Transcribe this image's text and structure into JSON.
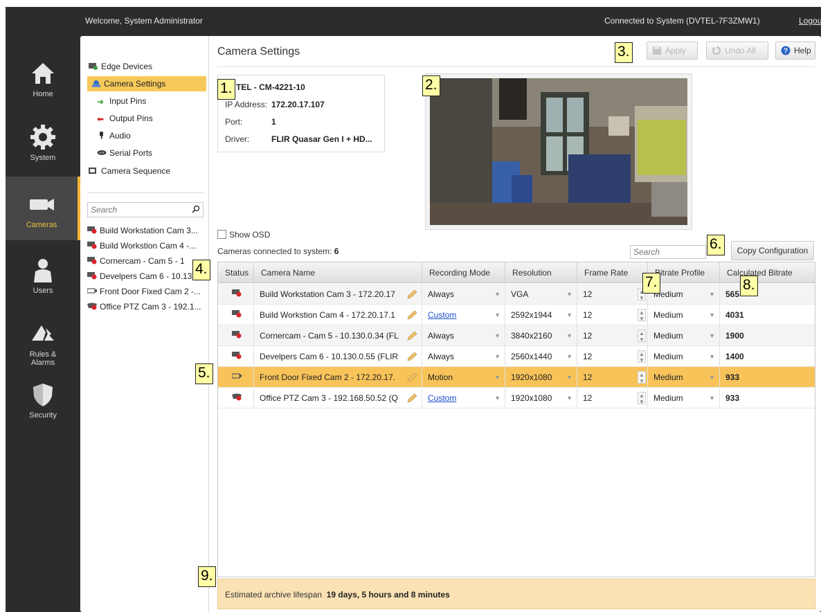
{
  "topbar": {
    "welcome": "Welcome, System Administrator",
    "connection": "Connected to System (DVTEL-7F3ZMW1)",
    "logout": "Logout"
  },
  "nav": [
    {
      "label": "Home",
      "icon": "home-icon"
    },
    {
      "label": "System",
      "icon": "gear-icon"
    },
    {
      "label": "Cameras",
      "icon": "camera-icon",
      "active": true
    },
    {
      "label": "Users",
      "icon": "user-icon"
    },
    {
      "label": "Rules &\nAlarms",
      "icon": "rules-alarm-icon"
    },
    {
      "label": "Security",
      "icon": "shield-icon"
    }
  ],
  "tree": {
    "edge_devices": "Edge Devices",
    "camera_settings": "Camera Settings",
    "input_pins": "Input Pins",
    "output_pins": "Output Pins",
    "audio": "Audio",
    "serial_ports": "Serial Ports",
    "camera_sequence": "Camera Sequence",
    "search_placeholder": "Search",
    "cameras": [
      "Build Workstation Cam 3...",
      "Build Workstion Cam 4 -...",
      "Cornercam - Cam 5 - 1",
      "Develpers Cam 6 - 10.13...",
      "Front Door Fixed Cam 2 -...",
      "Office PTZ Cam 3 - 192.1..."
    ]
  },
  "main": {
    "title": "Camera Settings",
    "apply": "Apply",
    "undo_all": "Undo All",
    "help": "Help",
    "info": {
      "name": "TEL - CM-4221-10",
      "ip_label": "IP Address:",
      "ip": "172.20.17.107",
      "port_label": "Port:",
      "port": "1",
      "driver_label": "Driver:",
      "driver": "FLIR Quasar Gen I + HD..."
    },
    "show_osd": "Show OSD",
    "connected_label": "Cameras connected to system:",
    "connected_count": "6",
    "search_placeholder": "Search",
    "copy_configuration": "Copy Configuration",
    "footer_label": "Estimated archive lifespan",
    "footer_value": "19 days, 5 hours and 8 minutes"
  },
  "grid": {
    "headers": [
      "Status",
      "Camera Name",
      "Recording Mode",
      "Resolution",
      "Frame Rate",
      "Bitrate Profile",
      "Calculated Bitrate"
    ],
    "rows": [
      {
        "name": "Build Workstation Cam 3 - 172.20.17",
        "mode": "Always",
        "resolution": "VGA",
        "frame_rate": "12",
        "profile": "Medium",
        "bitrate": "565",
        "status": "camera-error-icon"
      },
      {
        "name": "Build Workstion Cam 4 - 172.20.17.1",
        "mode": "Custom",
        "resolution": "2592x1944",
        "frame_rate": "12",
        "profile": "Medium",
        "bitrate": "4031",
        "status": "camera-error-icon"
      },
      {
        "name": "Cornercam - Cam 5 - 10.130.0.34 (FL",
        "mode": "Always",
        "resolution": "3840x2160",
        "frame_rate": "12",
        "profile": "Medium",
        "bitrate": "1900",
        "status": "camera-error-icon"
      },
      {
        "name": "Develpers Cam 6 - 10.130.0.55 (FLIR",
        "mode": "Always",
        "resolution": "2560x1440",
        "frame_rate": "12",
        "profile": "Medium",
        "bitrate": "1400",
        "status": "camera-error-icon"
      },
      {
        "name": "Front Door Fixed Cam 2 - 172.20.17.",
        "mode": "Motion",
        "resolution": "1920x1080",
        "frame_rate": "12",
        "profile": "Medium",
        "bitrate": "933",
        "status": "camera-ok-icon"
      },
      {
        "name": "Office PTZ Cam 3 - 192.168.50.52 (Q",
        "mode": "Custom",
        "resolution": "1920x1080",
        "frame_rate": "12",
        "profile": "Medium",
        "bitrate": "933",
        "status": "ptz-camera-error-icon"
      }
    ]
  },
  "markers": [
    "1.",
    "2.",
    "3.",
    "4.",
    "5.",
    "6.",
    "7.",
    "8.",
    "9."
  ],
  "colors": {
    "accent": "#f3b735",
    "selection": "#f8c45a",
    "link": "#1a4fcf",
    "footer": "#fbe2b5",
    "alert": "#d9262c"
  }
}
